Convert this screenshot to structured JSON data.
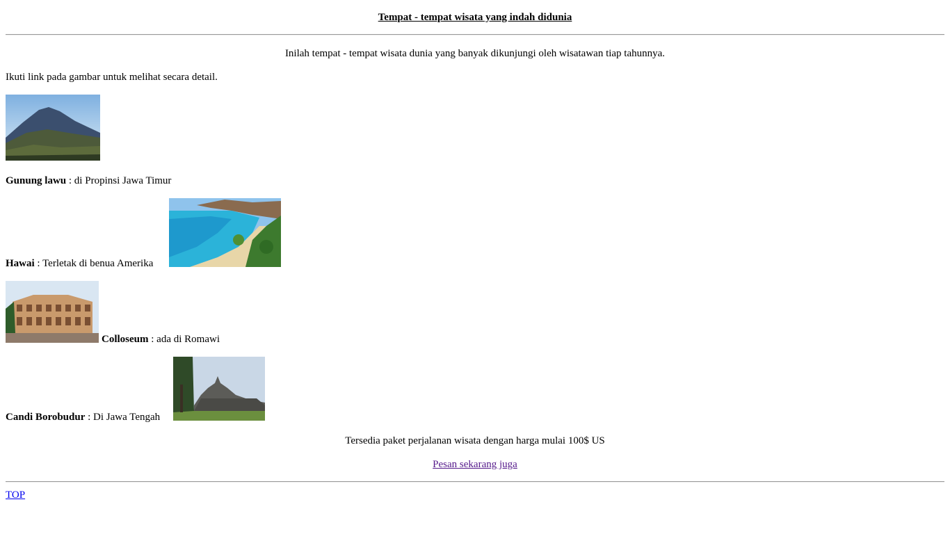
{
  "header": {
    "title": "Tempat - tempat wisata yang indah didunia"
  },
  "intro": {
    "line1": "Inilah tempat - tempat wisata dunia yang banyak dikunjungi oleh wisatawan tiap tahunnya.",
    "line2": "Ikuti link pada gambar untuk melihat secara detail."
  },
  "places": [
    {
      "name": "Gunung lawu",
      "desc": " : di Propinsi Jawa Timur"
    },
    {
      "name": "Hawai",
      "desc": " : Terletak di benua Amerika"
    },
    {
      "name": "Colloseum",
      "desc": " : ada di Romawi"
    },
    {
      "name": "Candi Borobudur",
      "desc": " : Di Jawa Tengah"
    }
  ],
  "footer": {
    "package_text": "Tersedia paket perjalanan wisata dengan harga mulai 100$ US",
    "order_link": "Pesan sekarang juga",
    "top_link": "TOP"
  }
}
